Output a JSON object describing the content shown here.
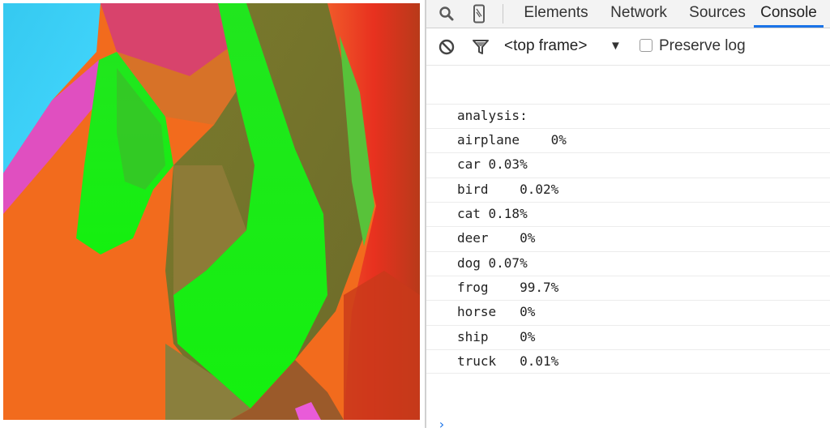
{
  "devtools": {
    "tabs": [
      {
        "label": "Elements",
        "active": false
      },
      {
        "label": "Network",
        "active": false
      },
      {
        "label": "Sources",
        "active": false
      },
      {
        "label": "Console",
        "active": true
      }
    ],
    "icons": {
      "inspect": "search-icon",
      "device": "device-mode-icon",
      "clear": "clear-console-icon",
      "filter": "filter-icon",
      "dropdown": "dropdown-arrow-icon"
    },
    "frame_selector": "<top frame>",
    "preserve_log": {
      "label": "Preserve log",
      "checked": false
    }
  },
  "console": {
    "lines": [
      "analysis:",
      "airplane    0%",
      "car 0.03%",
      "bird    0.02%",
      "cat 0.18%",
      "deer    0%",
      "dog 0.07%",
      "frog    99.7%",
      "horse   0%",
      "ship    0%",
      "truck   0.01%"
    ]
  },
  "colors": {
    "accent": "#1a73e8",
    "active_tab_underline": "#1a73e8"
  }
}
